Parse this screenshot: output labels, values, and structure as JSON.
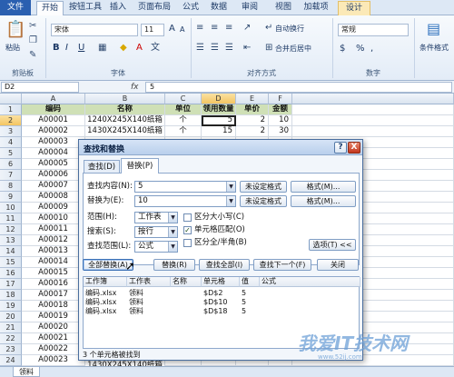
{
  "ribbon_tabs": [
    "文件",
    "开始",
    "按钮工具",
    "插入",
    "页面布局",
    "公式",
    "数据",
    "审阅",
    "视图",
    "加载项",
    "设计"
  ],
  "ribbon": {
    "paste": "粘贴",
    "font_name": "宋体",
    "font_size": "11",
    "bold": "B",
    "italic": "I",
    "underline": "U",
    "wrap_text": "自动换行",
    "merge_center": "合并后居中",
    "number_format": "常规",
    "cond_format": "条件格式",
    "group_clipboard": "剪贴板",
    "group_font": "字体",
    "group_align": "对齐方式",
    "group_number": "数字",
    "percent": "%",
    "comma": ",",
    "increase_font": "A",
    "decrease_font": "A",
    "currency": "$"
  },
  "formula_bar": {
    "name_box": "D2",
    "fx": "fx",
    "value": "5"
  },
  "sheet": {
    "col_letters": [
      "A",
      "B",
      "C",
      "D",
      "E",
      "F"
    ],
    "row_numbers": [
      "1",
      "2",
      "3",
      "4",
      "5",
      "6",
      "7",
      "8",
      "9",
      "10",
      "11",
      "12",
      "13",
      "14",
      "15",
      "16",
      "17",
      "18",
      "19",
      "20",
      "21",
      "22",
      "23",
      "24"
    ],
    "headers": [
      "编码",
      "名称",
      "单位",
      "领用数量",
      "单价",
      "金额"
    ],
    "rows": [
      [
        "A00001",
        "1240X245X140纸箱",
        "个",
        "5",
        "2",
        "10"
      ],
      [
        "A00002",
        "1430X245X140纸箱",
        "个",
        "15",
        "2",
        "30"
      ],
      [
        "A00003",
        "",
        "",
        "",
        "",
        ""
      ],
      [
        "A00004",
        "",
        "",
        "",
        "",
        ""
      ],
      [
        "A00005",
        "",
        "",
        "",
        "",
        ""
      ],
      [
        "A00006",
        "",
        "",
        "",
        "",
        ""
      ],
      [
        "A00007",
        "",
        "",
        "",
        "",
        ""
      ],
      [
        "A00008",
        "",
        "",
        "",
        "",
        ""
      ],
      [
        "A00009",
        "",
        "",
        "",
        "",
        ""
      ],
      [
        "A00010",
        "",
        "",
        "",
        "",
        ""
      ],
      [
        "A00011",
        "",
        "",
        "",
        "",
        ""
      ],
      [
        "A00012",
        "",
        "",
        "",
        "",
        ""
      ],
      [
        "A00013",
        "",
        "",
        "",
        "",
        ""
      ],
      [
        "A00014",
        "",
        "",
        "",
        "",
        ""
      ],
      [
        "A00015",
        "",
        "",
        "",
        "",
        ""
      ],
      [
        "A00016",
        "",
        "",
        "",
        "",
        ""
      ],
      [
        "A00017",
        "",
        "",
        "",
        "",
        ""
      ],
      [
        "A00018",
        "",
        "",
        "",
        "",
        ""
      ],
      [
        "A00019",
        "",
        "",
        "",
        "",
        ""
      ],
      [
        "A00020",
        "",
        "",
        "",
        "",
        ""
      ],
      [
        "A00021",
        "",
        "",
        "",
        "",
        ""
      ],
      [
        "A00022",
        "",
        "",
        "",
        "",
        ""
      ],
      [
        "A00023",
        "",
        "",
        "",
        "",
        ""
      ]
    ],
    "sheet_tab": "领料",
    "partial_bottom_cell": "1430X245X140纸箱"
  },
  "dialog": {
    "title": "查找和替换",
    "help": "?",
    "close": "X",
    "tab_find": "查找(D)",
    "tab_replace": "替换(P)",
    "find_label": "查找内容(N):",
    "find_value": "5",
    "replace_label": "替换为(E):",
    "replace_value": "10",
    "no_format": "未设定格式",
    "format_btn": "格式(M)...",
    "within_label": "范围(H):",
    "within_value": "工作表",
    "search_label": "搜索(S):",
    "search_value": "按行",
    "lookin_label": "查找范围(L):",
    "lookin_value": "公式",
    "match_case": "区分大小写(C)",
    "match_cell": "单元格匹配(O)",
    "match_byte": "区分全/半角(B)",
    "options_btn": "选项(T) <<",
    "replace_all": "全部替换(A)",
    "replace": "替换(R)",
    "find_all": "查找全部(I)",
    "find_next": "查找下一个(F)",
    "close_btn": "关闭",
    "results_headers": [
      "工作簿",
      "工作表",
      "名称",
      "单元格",
      "值",
      "公式"
    ],
    "results": [
      [
        "编码.xlsx",
        "领料",
        "",
        "$D$2",
        "5",
        ""
      ],
      [
        "编码.xlsx",
        "领料",
        "",
        "$D$10",
        "5",
        ""
      ],
      [
        "编码.xlsx",
        "领料",
        "",
        "$D$18",
        "5",
        ""
      ]
    ],
    "found_text": "3 个单元格被找到"
  },
  "watermark": {
    "text": "我爱IT技术网",
    "sub": "www.52ij.com"
  }
}
